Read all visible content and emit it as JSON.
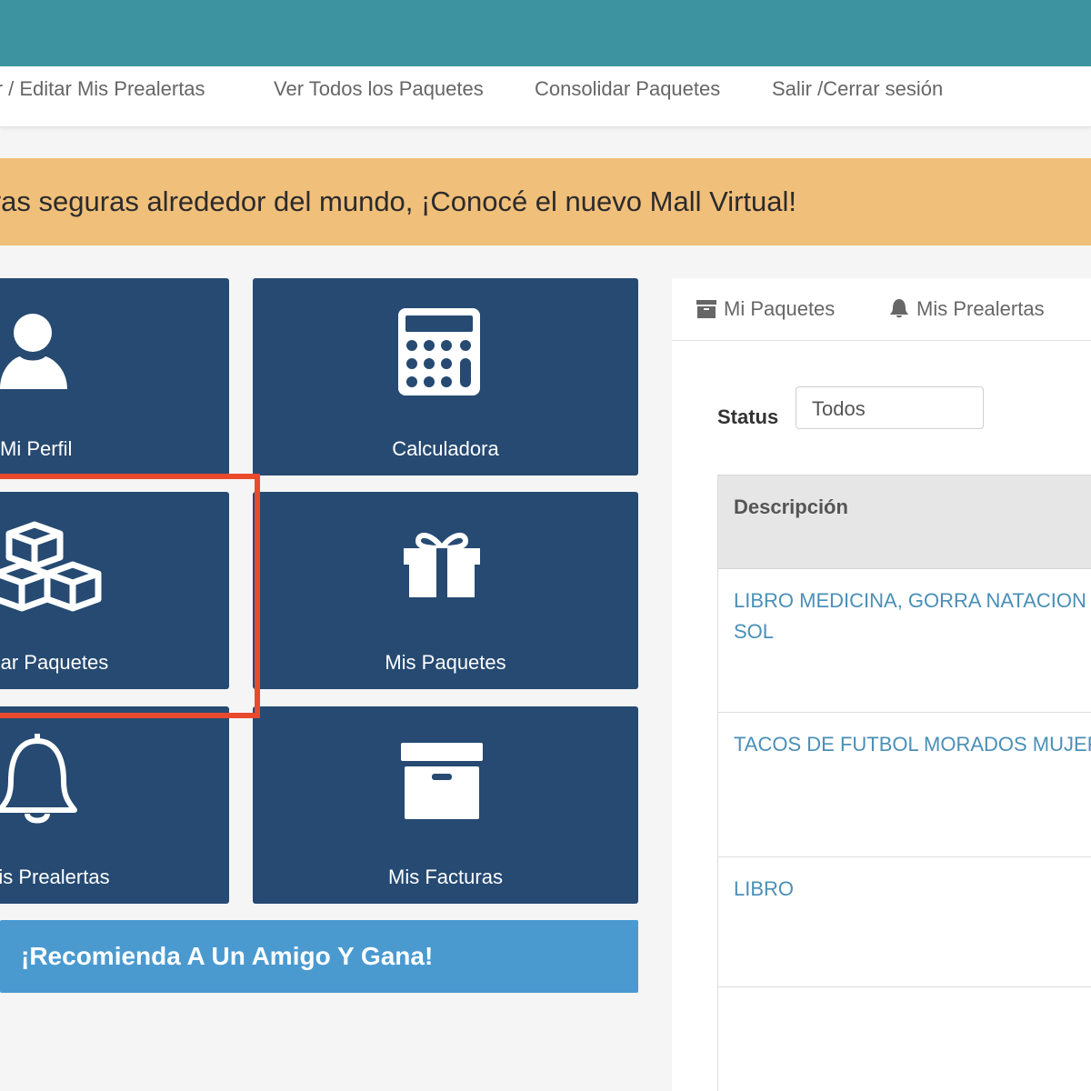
{
  "nav": {
    "items": [
      "Ver / Editar Mis Prealertas",
      "Ver Todos los Paquetes",
      "Consolidar Paquetes",
      "Salir /Cerrar sesión"
    ]
  },
  "banner": {
    "text": "Compras seguras alrededor del mundo, ¡Conocé el nuevo Mall Virtual!"
  },
  "tiles": [
    {
      "label": "Mi Perfil",
      "icon": "user-icon"
    },
    {
      "label": "Calculadora",
      "icon": "calculator-icon"
    },
    {
      "label": "Consolidar Paquetes",
      "icon": "cubes-icon"
    },
    {
      "label": "Mis Paquetes",
      "icon": "gift-icon"
    },
    {
      "label": "Mis Prealertas",
      "icon": "bell-icon"
    },
    {
      "label": "Mis Facturas",
      "icon": "archive-box-icon"
    }
  ],
  "promo": {
    "text": "¡Recomienda A Un Amigo Y Gana!"
  },
  "panel": {
    "tabs": [
      {
        "label": "Mi Paquetes",
        "icon": "archive-icon"
      },
      {
        "label": "Mis Prealertas",
        "icon": "bell-icon"
      }
    ],
    "status_label": "Status",
    "status_value": "Todos",
    "table": {
      "header": "Descripción",
      "rows": [
        "LIBRO MEDICINA, GORRA NATACION SOL",
        "TACOS DE FUTBOL MORADOS MUJER",
        "LIBRO"
      ]
    }
  },
  "colors": {
    "topbar": "#3d94a0",
    "tile": "#264a72",
    "banner": "#f0bf7a",
    "promo": "#4a9ad0",
    "highlight": "#e94a2c",
    "link": "#4a8fb7"
  }
}
